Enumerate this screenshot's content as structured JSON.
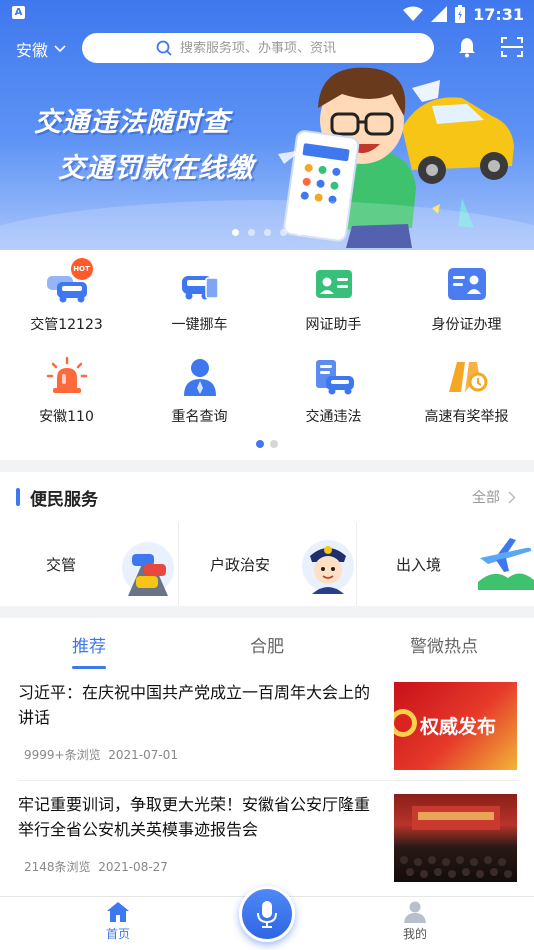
{
  "status_bar": {
    "time": "17:31"
  },
  "header": {
    "city": "安徽",
    "search_placeholder": "搜索服务项、办事项、资讯"
  },
  "banner": {
    "line1": "交通违法随时查",
    "line2": "交通罚款在线缴",
    "dot_count": 5,
    "active_dot": 0
  },
  "quick_grid": {
    "hot_badge": "HOT",
    "items": [
      {
        "label": "交管12123",
        "icon": "double-car-icon",
        "color": "#3f78ee"
      },
      {
        "label": "一键挪车",
        "icon": "car-phone-icon",
        "color": "#3f78ee"
      },
      {
        "label": "网证助手",
        "icon": "id-card-green-icon",
        "color": "#36c07a"
      },
      {
        "label": "身份证办理",
        "icon": "id-card-blue-icon",
        "color": "#4b7cf0"
      },
      {
        "label": "安徽110",
        "icon": "police-light-icon",
        "color": "#ff6a3d"
      },
      {
        "label": "重名查询",
        "icon": "person-icon",
        "color": "#3f78ee"
      },
      {
        "label": "交通违法",
        "icon": "traffic-violation-icon",
        "color": "#3f78ee"
      },
      {
        "label": "高速有奖举报",
        "icon": "highway-report-icon",
        "color": "#f5a623"
      }
    ],
    "page_count": 2,
    "active_page": 0
  },
  "services": {
    "title": "便民服务",
    "more_label": "全部",
    "items": [
      {
        "label": "交管",
        "icon": "traffic-cars-icon"
      },
      {
        "label": "户政治安",
        "icon": "police-officer-icon"
      },
      {
        "label": "出入境",
        "icon": "airplane-icon"
      }
    ]
  },
  "news": {
    "tabs": [
      {
        "label": "推荐",
        "active": true
      },
      {
        "label": "合肥",
        "active": false
      },
      {
        "label": "警微热点",
        "active": false
      }
    ],
    "articles": [
      {
        "title": "习近平：在庆祝中国共产党成立一百周年大会上的讲话",
        "views": "9999+条浏览",
        "date": "2021-07-01",
        "thumb_text": "权威发布"
      },
      {
        "title": "牢记重要训词，争取更大光荣！安徽省公安厅隆重举行全省公安机关英模事迹报告会",
        "views": "2148条浏览",
        "date": "2021-08-27"
      }
    ]
  },
  "bottom_nav": {
    "home_label": "首页",
    "mine_label": "我的",
    "accent": "#3f78ee"
  }
}
